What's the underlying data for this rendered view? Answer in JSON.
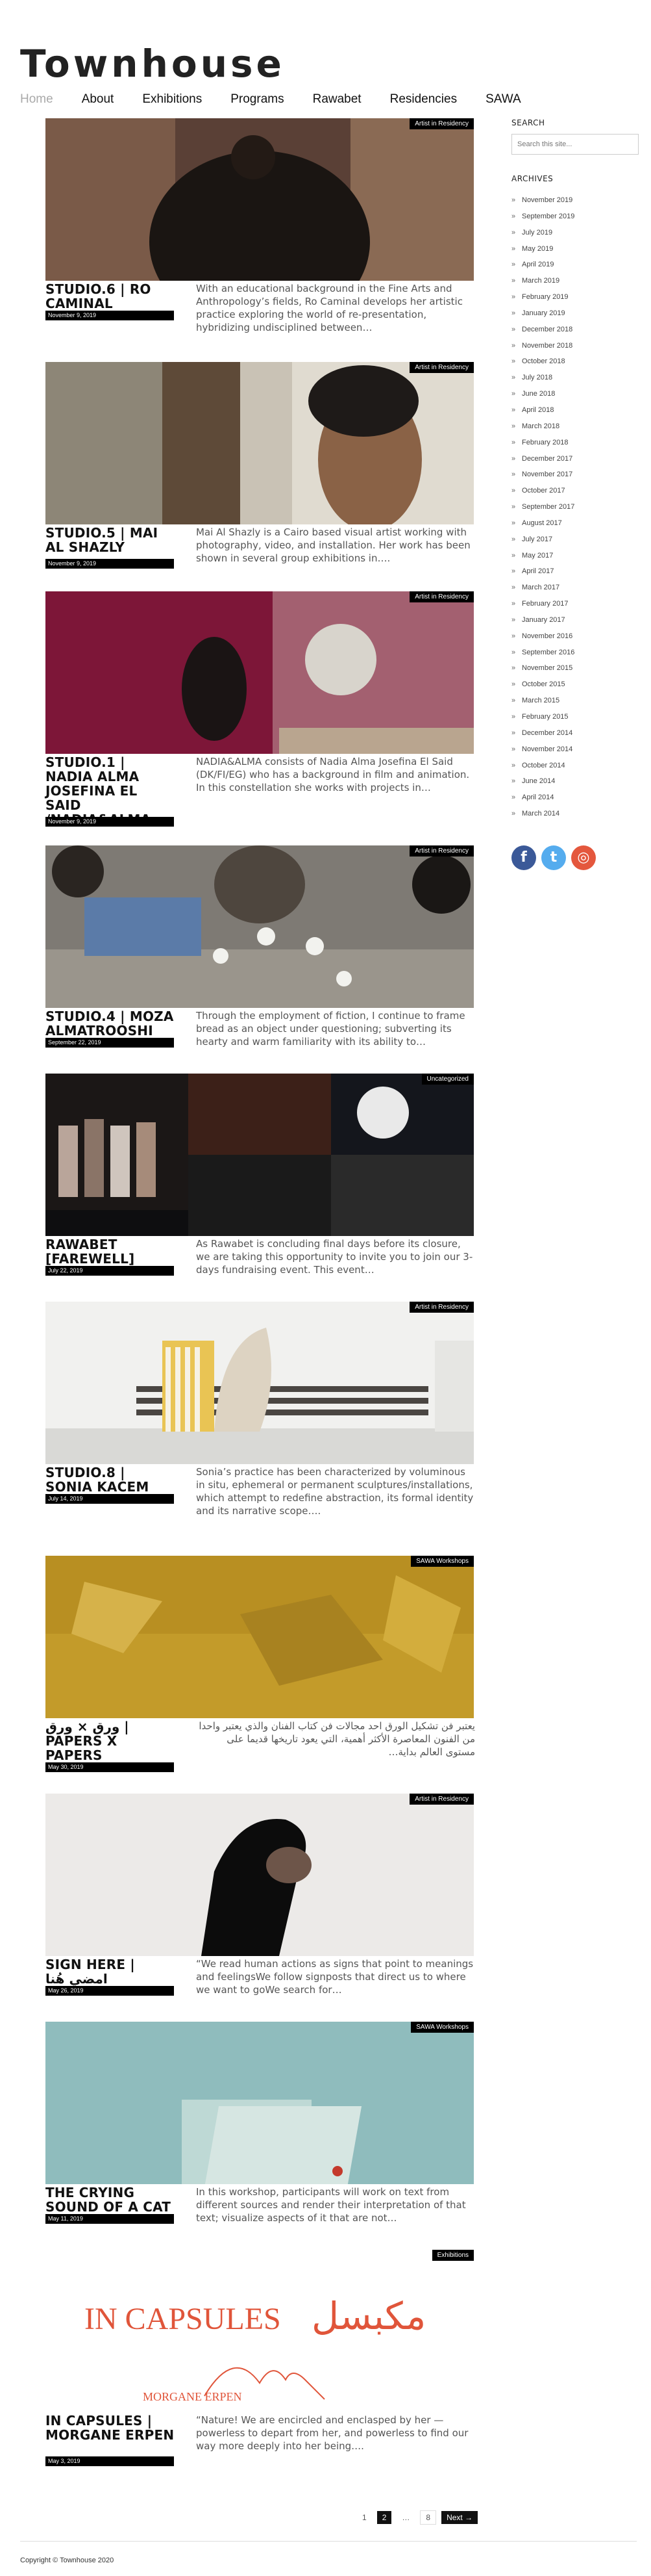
{
  "site": {
    "title": "Townhouse"
  },
  "nav": {
    "items": [
      {
        "label": "Home"
      },
      {
        "label": "About"
      },
      {
        "label": "Exhibitions"
      },
      {
        "label": "Programs"
      },
      {
        "label": "Rawabet"
      },
      {
        "label": "Residencies"
      },
      {
        "label": "SAWA"
      }
    ]
  },
  "posts": [
    {
      "category": "Artist in Residency",
      "title": "STUDIO.6 | RO CAMINAL",
      "date": "November 9, 2019",
      "excerpt": "With an educational background in the Fine Arts and Anthropology’s fields, Ro Caminal develops her artistic practice exploring the world of re-presentation, hybridizing undisciplined between…"
    },
    {
      "category": "Artist in Residency",
      "title": "STUDIO.5 | MAI AL SHAZLY",
      "date": "November 9, 2019",
      "excerpt": "Mai Al Shazly is a Cairo based visual artist working with photography, video, and installation. Her work has been shown in several group exhibitions in…."
    },
    {
      "category": "Artist in Residency",
      "title": "STUDIO.1 | NADIA ALMA JOSEFINA EL SAID /NADIA&ALMA",
      "date": "November 9, 2019",
      "excerpt": "NADIA&ALMA consists of Nadia Alma Josefina El Said (DK/FI/EG) who has a background in film and animation. In this constellation she works with projects in…"
    },
    {
      "category": "Artist in Residency",
      "title": "STUDIO.4 | MOZA ALMATROOSHI",
      "date": "September 22, 2019",
      "excerpt": "Through the employment of fiction, I continue to frame bread as an object under questioning; subverting its hearty and warm familiarity with its ability to…"
    },
    {
      "category": "Uncategorized",
      "title": "RAWABET [FAREWELL]",
      "date": "July 22, 2019",
      "excerpt": "As Rawabet is concluding final days before its closure, we are taking this opportunity to invite you to join our 3-days fundraising event. This event…"
    },
    {
      "category": "Artist in Residency",
      "title": "STUDIO.8 | SONIA KACEM",
      "date": "July 14, 2019",
      "excerpt": "Sonia’s practice has been characterized by voluminous in situ, ephemeral or permanent sculptures/installations, which attempt to redefine abstraction, its formal identity and its narrative scope…."
    },
    {
      "category": "SAWA Workshops",
      "title": "ورق × ورق | PAPERS X PAPERS",
      "date": "May 30, 2019",
      "excerpt": "يعتبر فن تشكيل الورق احد مجالات فن كتاب الفنان والذي يعتبر واحدا من الفنون المعاصرة الأكثر أهمية، التي يعود تاريخها قديما على مستوى العالم بداية…"
    },
    {
      "category": "Artist in Residency",
      "title": "SIGN HERE | امضي هُنا",
      "date": "May 26, 2019",
      "excerpt": "“We read human actions as signs that point to meanings and feelingsWe follow signposts that direct us to where we want to goWe search for…"
    },
    {
      "category": "SAWA Workshops",
      "title": "THE CRYING SOUND OF A CAT",
      "date": "May 11, 2019",
      "excerpt": "In this workshop, participants will work on text from different sources and render their interpretation of that text; visualize aspects of it that are not…"
    },
    {
      "category": "Exhibitions",
      "title": "IN CAPSULES | MORGANE ERPEN",
      "date": "May 3, 2019",
      "excerpt": "“Nature! We are encircled and enclasped by her — powerless to depart from her, and powerless to find our way more deeply into her being….",
      "image_text": {
        "en": "IN CAPSULES",
        "ar": "مكبسل",
        "name": "MORGANE ERPEN"
      }
    }
  ],
  "sidebar": {
    "search_title": "SEARCH",
    "search_placeholder": "Search this site...",
    "archives_title": "ARCHIVES",
    "archives": [
      "November 2019",
      "September 2019",
      "July 2019",
      "May 2019",
      "April 2019",
      "March 2019",
      "February 2019",
      "January 2019",
      "December 2018",
      "November 2018",
      "October 2018",
      "July 2018",
      "June 2018",
      "April 2018",
      "March 2018",
      "February 2018",
      "December 2017",
      "November 2017",
      "October 2017",
      "September 2017",
      "August 2017",
      "July 2017",
      "May 2017",
      "April 2017",
      "March 2017",
      "February 2017",
      "January 2017",
      "November 2016",
      "September 2016",
      "November 2015",
      "October 2015",
      "March 2015",
      "February 2015",
      "December 2014",
      "November 2014",
      "October 2014",
      "June 2014",
      "April 2014",
      "March 2014"
    ],
    "social": [
      {
        "icon": "facebook-icon",
        "glyph": "f",
        "color": "#3b5998"
      },
      {
        "icon": "twitter-icon",
        "glyph": "t",
        "color": "#55acee"
      },
      {
        "icon": "instagram-icon",
        "glyph": "◎",
        "color": "#e4573d"
      }
    ]
  },
  "pagination": {
    "current": "1",
    "page2": "2",
    "ellipsis": "…",
    "last": "8",
    "next": "Next →"
  },
  "footer": {
    "copyright": "Copyright © Townhouse 2020"
  }
}
